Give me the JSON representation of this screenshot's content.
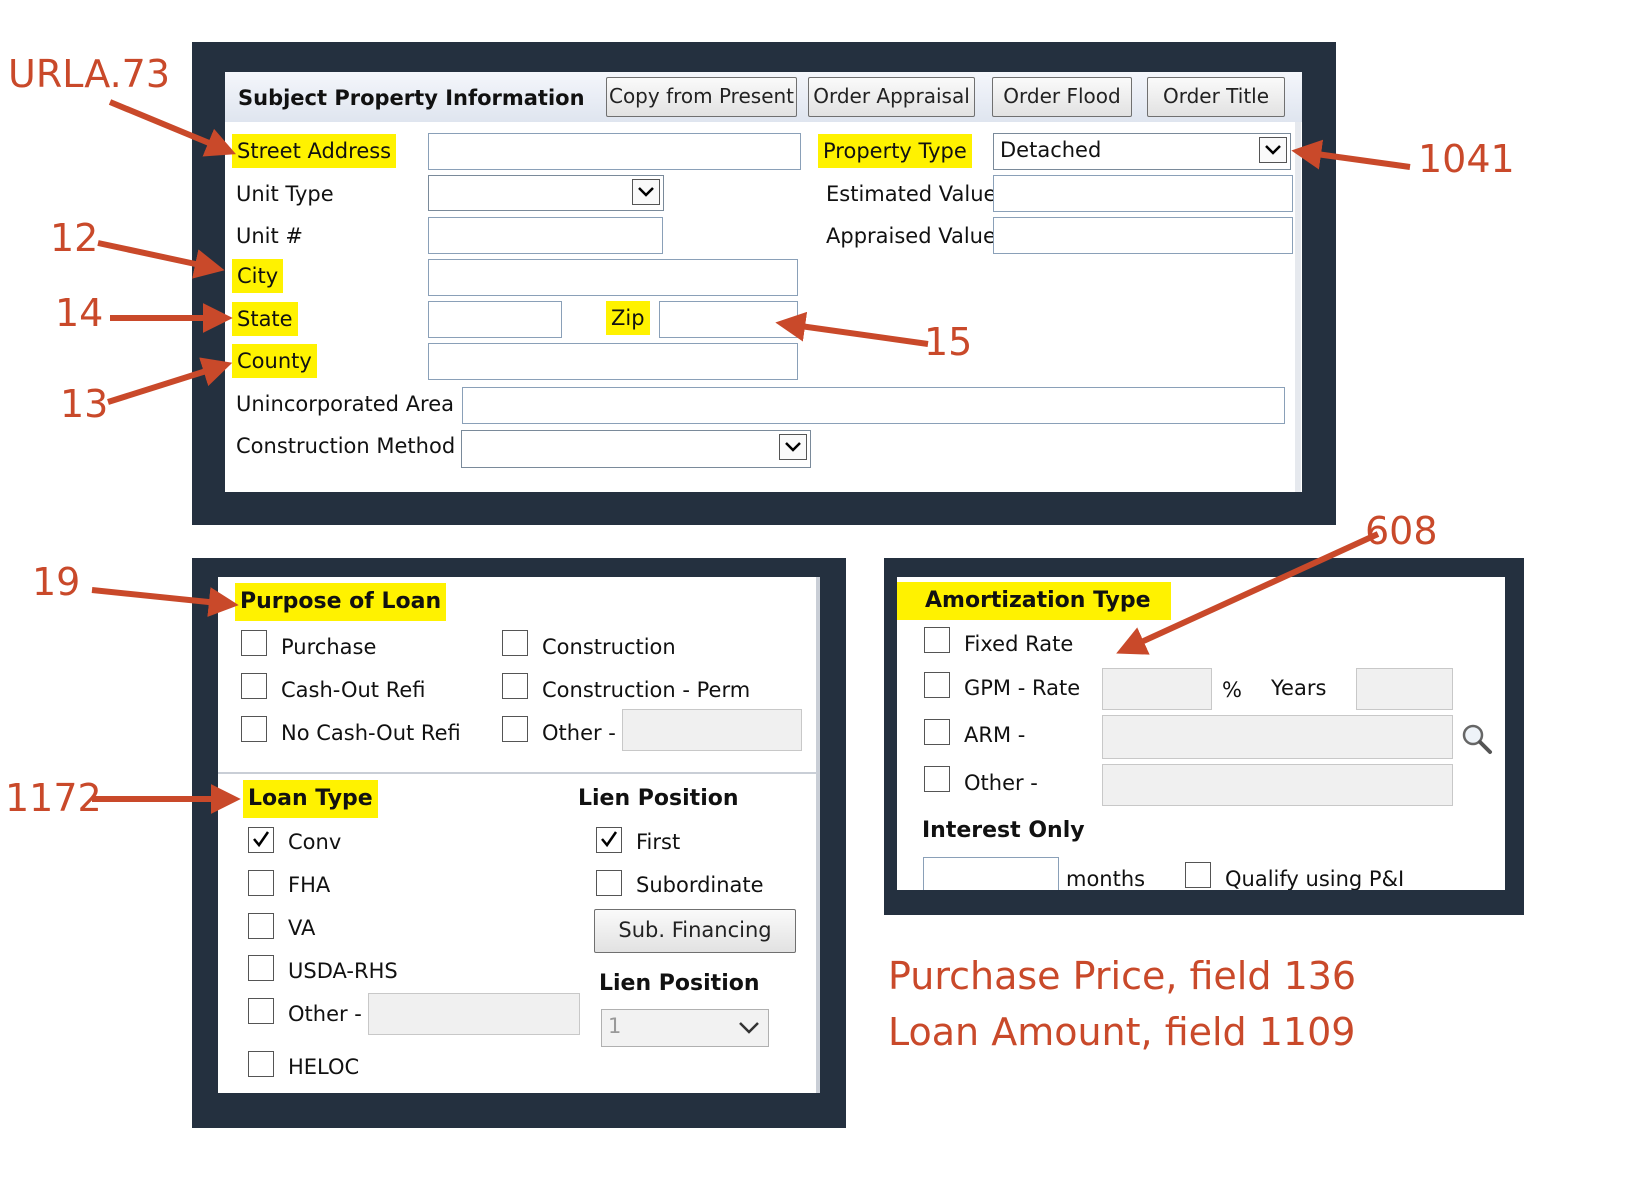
{
  "annotations": {
    "urla": "URLA.73",
    "n1041": "1041",
    "n12": "12",
    "n14": "14",
    "n13": "13",
    "n15": "15",
    "n19": "19",
    "n608": "608",
    "n1172": "1172",
    "purchase_price": "Purchase Price, field 136",
    "loan_amount": "Loan Amount, field 1109"
  },
  "subject_property": {
    "title": "Subject Property Information",
    "buttons": {
      "copy_from_present": "Copy from Present",
      "order_appraisal": "Order Appraisal",
      "order_flood": "Order Flood",
      "order_title": "Order Title"
    },
    "labels": {
      "street_address": "Street Address",
      "unit_type": "Unit Type",
      "unit_number": "Unit #",
      "city": "City",
      "state": "State",
      "zip": "Zip",
      "county": "County",
      "unincorporated_area": "Unincorporated Area",
      "construction_method": "Construction Method",
      "property_type": "Property Type",
      "estimated_value": "Estimated Value",
      "appraised_value": "Appraised Value"
    },
    "property_type_value": "Detached"
  },
  "purpose_of_loan": {
    "title": "Purpose of Loan",
    "options": {
      "purchase": "Purchase",
      "cash_out_refi": "Cash-Out Refi",
      "no_cash_out_refi": "No Cash-Out Refi",
      "construction": "Construction",
      "construction_perm": "Construction - Perm",
      "other": "Other -"
    }
  },
  "loan_type": {
    "title": "Loan Type",
    "options": {
      "conv": "Conv",
      "fha": "FHA",
      "va": "VA",
      "usda_rhs": "USDA-RHS",
      "other": "Other -",
      "heloc": "HELOC"
    },
    "checked": [
      "conv"
    ]
  },
  "lien_position": {
    "title": "Lien Position",
    "first": "First",
    "subordinate": "Subordinate",
    "sub_financing": "Sub. Financing",
    "title2": "Lien Position",
    "select_value": "1"
  },
  "amortization": {
    "title": "Amortization Type",
    "fixed_rate": "Fixed Rate",
    "gpm_rate": "GPM - Rate",
    "percent": "%",
    "years": "Years",
    "arm": "ARM -",
    "other": "Other -",
    "interest_only": "Interest Only",
    "months": "months",
    "qualify": "Qualify using P&I"
  }
}
